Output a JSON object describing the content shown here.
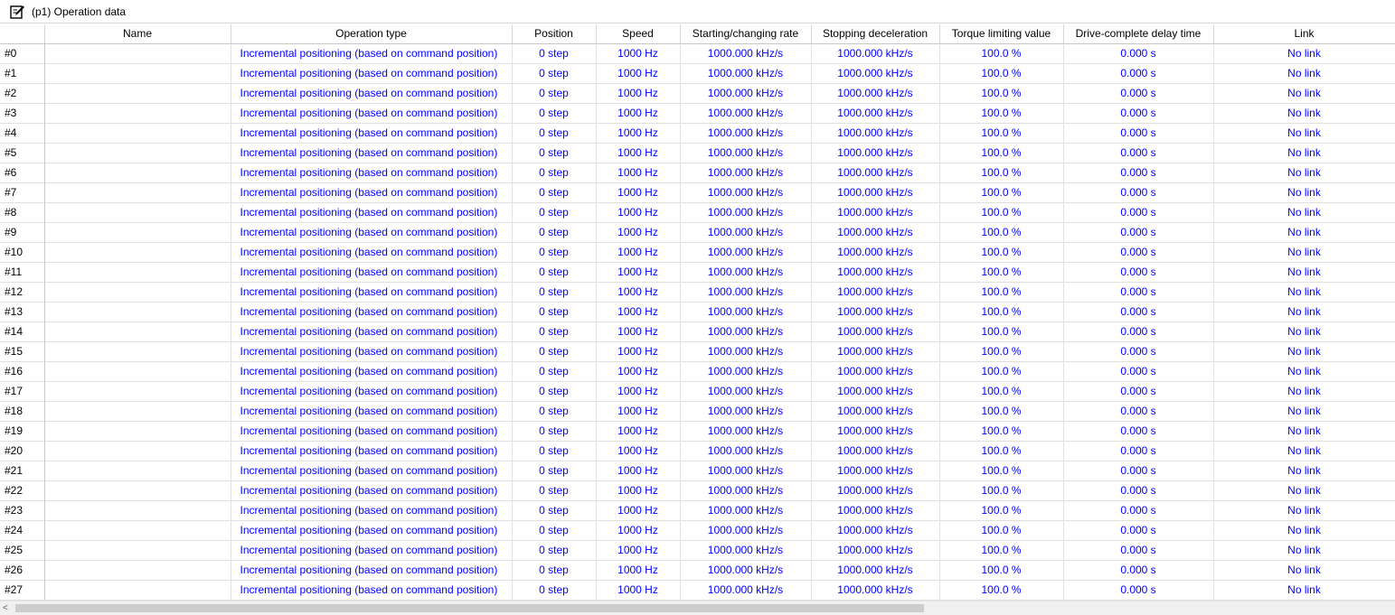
{
  "window": {
    "icon": "edit-document-icon",
    "title": "(p1) Operation data"
  },
  "table": {
    "columns": [
      "",
      "Name",
      "Operation type",
      "Position",
      "Speed",
      "Starting/changing rate",
      "Stopping deceleration",
      "Torque limiting value",
      "Drive-complete delay time",
      "Link"
    ],
    "rows": [
      {
        "id": "#0",
        "name": "",
        "operation_type": "Incremental positioning (based on command position)",
        "position": "0 step",
        "speed": "1000 Hz",
        "starting_changing_rate": "1000.000 kHz/s",
        "stopping_deceleration": "1000.000 kHz/s",
        "torque_limiting_value": "100.0 %",
        "drive_complete_delay_time": "0.000 s",
        "link": "No link"
      },
      {
        "id": "#1",
        "name": "",
        "operation_type": "Incremental positioning (based on command position)",
        "position": "0 step",
        "speed": "1000 Hz",
        "starting_changing_rate": "1000.000 kHz/s",
        "stopping_deceleration": "1000.000 kHz/s",
        "torque_limiting_value": "100.0 %",
        "drive_complete_delay_time": "0.000 s",
        "link": "No link"
      },
      {
        "id": "#2",
        "name": "",
        "operation_type": "Incremental positioning (based on command position)",
        "position": "0 step",
        "speed": "1000 Hz",
        "starting_changing_rate": "1000.000 kHz/s",
        "stopping_deceleration": "1000.000 kHz/s",
        "torque_limiting_value": "100.0 %",
        "drive_complete_delay_time": "0.000 s",
        "link": "No link"
      },
      {
        "id": "#3",
        "name": "",
        "operation_type": "Incremental positioning (based on command position)",
        "position": "0 step",
        "speed": "1000 Hz",
        "starting_changing_rate": "1000.000 kHz/s",
        "stopping_deceleration": "1000.000 kHz/s",
        "torque_limiting_value": "100.0 %",
        "drive_complete_delay_time": "0.000 s",
        "link": "No link"
      },
      {
        "id": "#4",
        "name": "",
        "operation_type": "Incremental positioning (based on command position)",
        "position": "0 step",
        "speed": "1000 Hz",
        "starting_changing_rate": "1000.000 kHz/s",
        "stopping_deceleration": "1000.000 kHz/s",
        "torque_limiting_value": "100.0 %",
        "drive_complete_delay_time": "0.000 s",
        "link": "No link"
      },
      {
        "id": "#5",
        "name": "",
        "operation_type": "Incremental positioning (based on command position)",
        "position": "0 step",
        "speed": "1000 Hz",
        "starting_changing_rate": "1000.000 kHz/s",
        "stopping_deceleration": "1000.000 kHz/s",
        "torque_limiting_value": "100.0 %",
        "drive_complete_delay_time": "0.000 s",
        "link": "No link"
      },
      {
        "id": "#6",
        "name": "",
        "operation_type": "Incremental positioning (based on command position)",
        "position": "0 step",
        "speed": "1000 Hz",
        "starting_changing_rate": "1000.000 kHz/s",
        "stopping_deceleration": "1000.000 kHz/s",
        "torque_limiting_value": "100.0 %",
        "drive_complete_delay_time": "0.000 s",
        "link": "No link"
      },
      {
        "id": "#7",
        "name": "",
        "operation_type": "Incremental positioning (based on command position)",
        "position": "0 step",
        "speed": "1000 Hz",
        "starting_changing_rate": "1000.000 kHz/s",
        "stopping_deceleration": "1000.000 kHz/s",
        "torque_limiting_value": "100.0 %",
        "drive_complete_delay_time": "0.000 s",
        "link": "No link"
      },
      {
        "id": "#8",
        "name": "",
        "operation_type": "Incremental positioning (based on command position)",
        "position": "0 step",
        "speed": "1000 Hz",
        "starting_changing_rate": "1000.000 kHz/s",
        "stopping_deceleration": "1000.000 kHz/s",
        "torque_limiting_value": "100.0 %",
        "drive_complete_delay_time": "0.000 s",
        "link": "No link"
      },
      {
        "id": "#9",
        "name": "",
        "operation_type": "Incremental positioning (based on command position)",
        "position": "0 step",
        "speed": "1000 Hz",
        "starting_changing_rate": "1000.000 kHz/s",
        "stopping_deceleration": "1000.000 kHz/s",
        "torque_limiting_value": "100.0 %",
        "drive_complete_delay_time": "0.000 s",
        "link": "No link"
      },
      {
        "id": "#10",
        "name": "",
        "operation_type": "Incremental positioning (based on command position)",
        "position": "0 step",
        "speed": "1000 Hz",
        "starting_changing_rate": "1000.000 kHz/s",
        "stopping_deceleration": "1000.000 kHz/s",
        "torque_limiting_value": "100.0 %",
        "drive_complete_delay_time": "0.000 s",
        "link": "No link"
      },
      {
        "id": "#11",
        "name": "",
        "operation_type": "Incremental positioning (based on command position)",
        "position": "0 step",
        "speed": "1000 Hz",
        "starting_changing_rate": "1000.000 kHz/s",
        "stopping_deceleration": "1000.000 kHz/s",
        "torque_limiting_value": "100.0 %",
        "drive_complete_delay_time": "0.000 s",
        "link": "No link"
      },
      {
        "id": "#12",
        "name": "",
        "operation_type": "Incremental positioning (based on command position)",
        "position": "0 step",
        "speed": "1000 Hz",
        "starting_changing_rate": "1000.000 kHz/s",
        "stopping_deceleration": "1000.000 kHz/s",
        "torque_limiting_value": "100.0 %",
        "drive_complete_delay_time": "0.000 s",
        "link": "No link"
      },
      {
        "id": "#13",
        "name": "",
        "operation_type": "Incremental positioning (based on command position)",
        "position": "0 step",
        "speed": "1000 Hz",
        "starting_changing_rate": "1000.000 kHz/s",
        "stopping_deceleration": "1000.000 kHz/s",
        "torque_limiting_value": "100.0 %",
        "drive_complete_delay_time": "0.000 s",
        "link": "No link"
      },
      {
        "id": "#14",
        "name": "",
        "operation_type": "Incremental positioning (based on command position)",
        "position": "0 step",
        "speed": "1000 Hz",
        "starting_changing_rate": "1000.000 kHz/s",
        "stopping_deceleration": "1000.000 kHz/s",
        "torque_limiting_value": "100.0 %",
        "drive_complete_delay_time": "0.000 s",
        "link": "No link"
      },
      {
        "id": "#15",
        "name": "",
        "operation_type": "Incremental positioning (based on command position)",
        "position": "0 step",
        "speed": "1000 Hz",
        "starting_changing_rate": "1000.000 kHz/s",
        "stopping_deceleration": "1000.000 kHz/s",
        "torque_limiting_value": "100.0 %",
        "drive_complete_delay_time": "0.000 s",
        "link": "No link"
      },
      {
        "id": "#16",
        "name": "",
        "operation_type": "Incremental positioning (based on command position)",
        "position": "0 step",
        "speed": "1000 Hz",
        "starting_changing_rate": "1000.000 kHz/s",
        "stopping_deceleration": "1000.000 kHz/s",
        "torque_limiting_value": "100.0 %",
        "drive_complete_delay_time": "0.000 s",
        "link": "No link"
      },
      {
        "id": "#17",
        "name": "",
        "operation_type": "Incremental positioning (based on command position)",
        "position": "0 step",
        "speed": "1000 Hz",
        "starting_changing_rate": "1000.000 kHz/s",
        "stopping_deceleration": "1000.000 kHz/s",
        "torque_limiting_value": "100.0 %",
        "drive_complete_delay_time": "0.000 s",
        "link": "No link"
      },
      {
        "id": "#18",
        "name": "",
        "operation_type": "Incremental positioning (based on command position)",
        "position": "0 step",
        "speed": "1000 Hz",
        "starting_changing_rate": "1000.000 kHz/s",
        "stopping_deceleration": "1000.000 kHz/s",
        "torque_limiting_value": "100.0 %",
        "drive_complete_delay_time": "0.000 s",
        "link": "No link"
      },
      {
        "id": "#19",
        "name": "",
        "operation_type": "Incremental positioning (based on command position)",
        "position": "0 step",
        "speed": "1000 Hz",
        "starting_changing_rate": "1000.000 kHz/s",
        "stopping_deceleration": "1000.000 kHz/s",
        "torque_limiting_value": "100.0 %",
        "drive_complete_delay_time": "0.000 s",
        "link": "No link"
      },
      {
        "id": "#20",
        "name": "",
        "operation_type": "Incremental positioning (based on command position)",
        "position": "0 step",
        "speed": "1000 Hz",
        "starting_changing_rate": "1000.000 kHz/s",
        "stopping_deceleration": "1000.000 kHz/s",
        "torque_limiting_value": "100.0 %",
        "drive_complete_delay_time": "0.000 s",
        "link": "No link"
      },
      {
        "id": "#21",
        "name": "",
        "operation_type": "Incremental positioning (based on command position)",
        "position": "0 step",
        "speed": "1000 Hz",
        "starting_changing_rate": "1000.000 kHz/s",
        "stopping_deceleration": "1000.000 kHz/s",
        "torque_limiting_value": "100.0 %",
        "drive_complete_delay_time": "0.000 s",
        "link": "No link"
      },
      {
        "id": "#22",
        "name": "",
        "operation_type": "Incremental positioning (based on command position)",
        "position": "0 step",
        "speed": "1000 Hz",
        "starting_changing_rate": "1000.000 kHz/s",
        "stopping_deceleration": "1000.000 kHz/s",
        "torque_limiting_value": "100.0 %",
        "drive_complete_delay_time": "0.000 s",
        "link": "No link"
      },
      {
        "id": "#23",
        "name": "",
        "operation_type": "Incremental positioning (based on command position)",
        "position": "0 step",
        "speed": "1000 Hz",
        "starting_changing_rate": "1000.000 kHz/s",
        "stopping_deceleration": "1000.000 kHz/s",
        "torque_limiting_value": "100.0 %",
        "drive_complete_delay_time": "0.000 s",
        "link": "No link"
      },
      {
        "id": "#24",
        "name": "",
        "operation_type": "Incremental positioning (based on command position)",
        "position": "0 step",
        "speed": "1000 Hz",
        "starting_changing_rate": "1000.000 kHz/s",
        "stopping_deceleration": "1000.000 kHz/s",
        "torque_limiting_value": "100.0 %",
        "drive_complete_delay_time": "0.000 s",
        "link": "No link"
      },
      {
        "id": "#25",
        "name": "",
        "operation_type": "Incremental positioning (based on command position)",
        "position": "0 step",
        "speed": "1000 Hz",
        "starting_changing_rate": "1000.000 kHz/s",
        "stopping_deceleration": "1000.000 kHz/s",
        "torque_limiting_value": "100.0 %",
        "drive_complete_delay_time": "0.000 s",
        "link": "No link"
      },
      {
        "id": "#26",
        "name": "",
        "operation_type": "Incremental positioning (based on command position)",
        "position": "0 step",
        "speed": "1000 Hz",
        "starting_changing_rate": "1000.000 kHz/s",
        "stopping_deceleration": "1000.000 kHz/s",
        "torque_limiting_value": "100.0 %",
        "drive_complete_delay_time": "0.000 s",
        "link": "No link"
      },
      {
        "id": "#27",
        "name": "",
        "operation_type": "Incremental positioning (based on command position)",
        "position": "0 step",
        "speed": "1000 Hz",
        "starting_changing_rate": "1000.000 kHz/s",
        "stopping_deceleration": "1000.000 kHz/s",
        "torque_limiting_value": "100.0 %",
        "drive_complete_delay_time": "0.000 s",
        "link": "No link"
      }
    ]
  },
  "scrollbar": {
    "left_arrow": "<"
  },
  "colors": {
    "value_text": "#0000ff",
    "grid_line": "#e0e0e0",
    "scrollbar_thumb": "#cdcdcd"
  }
}
